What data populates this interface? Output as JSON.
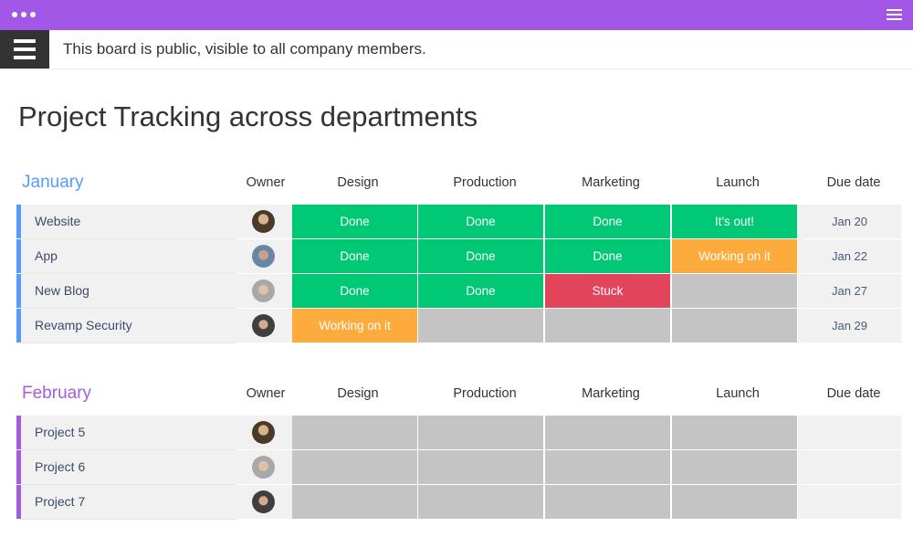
{
  "window": {
    "accent": "#a357e6",
    "menu_icon": "hamburger-icon",
    "window_dots_icon": "window-dots-icon"
  },
  "notice": {
    "text": "This board is public, visible to all company members."
  },
  "page": {
    "title": "Project Tracking across departments"
  },
  "columns": {
    "owner": "Owner",
    "design": "Design",
    "production": "Production",
    "marketing": "Marketing",
    "launch": "Launch",
    "due": "Due date"
  },
  "status_colors": {
    "Done": "#00c875",
    "It's out!": "#00c875",
    "Working on it": "#fdab3d",
    "Stuck": "#e2445c",
    "": "#c4c4c4"
  },
  "groups": [
    {
      "name": "January",
      "color": "#579bfc",
      "rows": [
        {
          "name": "Website",
          "avatar": "avatar-1",
          "design": "Done",
          "production": "Done",
          "marketing": "Done",
          "launch": "It's out!",
          "due": "Jan 20"
        },
        {
          "name": "App",
          "avatar": "avatar-2",
          "design": "Done",
          "production": "Done",
          "marketing": "Done",
          "launch": "Working on it",
          "due": "Jan 22"
        },
        {
          "name": "New Blog",
          "avatar": "avatar-3",
          "design": "Done",
          "production": "Done",
          "marketing": "Stuck",
          "launch": "",
          "due": "Jan 27"
        },
        {
          "name": "Revamp Security",
          "avatar": "avatar-4",
          "design": "Working on it",
          "production": "",
          "marketing": "",
          "launch": "",
          "due": "Jan 29"
        }
      ]
    },
    {
      "name": "February",
      "color": "#a25ddc",
      "rows": [
        {
          "name": "Project 5",
          "avatar": "avatar-1",
          "design": "",
          "production": "",
          "marketing": "",
          "launch": "",
          "due": ""
        },
        {
          "name": "Project 6",
          "avatar": "avatar-3",
          "design": "",
          "production": "",
          "marketing": "",
          "launch": "",
          "due": ""
        },
        {
          "name": "Project 7",
          "avatar": "avatar-4",
          "design": "",
          "production": "",
          "marketing": "",
          "launch": "",
          "due": ""
        }
      ]
    }
  ]
}
